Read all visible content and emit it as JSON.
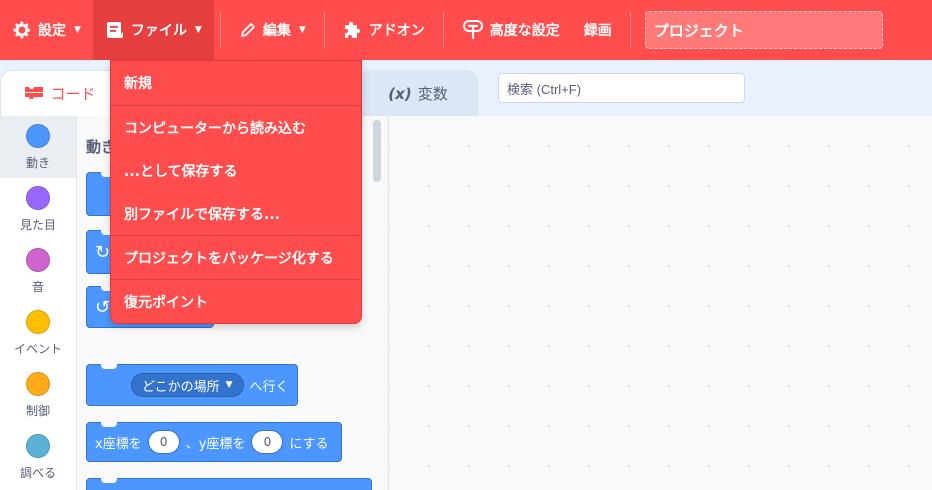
{
  "menubar": {
    "settings": "設定",
    "file": "ファイル",
    "edit": "編集",
    "addons": "アドオン",
    "advanced": "高度な設定",
    "record": "録画",
    "project_title": "プロジェクト"
  },
  "tabs": {
    "code": "コード",
    "vars_symbol": "(x)",
    "vars": "変数"
  },
  "search": {
    "placeholder": "検索 (Ctrl+F)"
  },
  "categories": [
    {
      "label": "動き",
      "color": "#4c97ff"
    },
    {
      "label": "見た目",
      "color": "#9966ff"
    },
    {
      "label": "音",
      "color": "#cf63cf"
    },
    {
      "label": "イベント",
      "color": "#ffbf00"
    },
    {
      "label": "制御",
      "color": "#ffab19"
    },
    {
      "label": "調べる",
      "color": "#5cb1d6"
    }
  ],
  "palette": {
    "heading": "動き",
    "goto_target": "どこかの場所",
    "goto_suffix": "へ行く",
    "setxy_x_label": "x座標を",
    "setxy_x_value": "0",
    "setxy_sep": "、y座標を",
    "setxy_y_value": "0",
    "setxy_suffix": "にする"
  },
  "file_menu": {
    "new": "新規",
    "load": "コンピューターから読み込む",
    "save_as": "...として保存する",
    "save_copy": "別ファイルで保存する...",
    "package": "プロジェクトをパッケージ化する",
    "restore": "復元ポイント"
  },
  "colors": {
    "menubar": "#ff4c4c",
    "motion": "#4c97ff"
  }
}
